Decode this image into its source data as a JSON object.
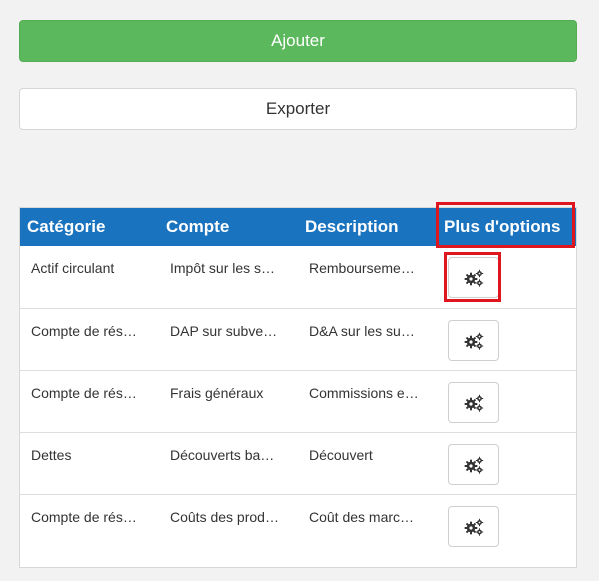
{
  "actions": {
    "add_label": "Ajouter",
    "export_label": "Exporter"
  },
  "table": {
    "headers": [
      "Catégorie",
      "Compte",
      "Description",
      "Plus d'options"
    ],
    "rows": [
      {
        "categorie": "Actif circulant",
        "compte": "Impôt sur les s…",
        "description": "Rembourseme…"
      },
      {
        "categorie": "Compte de rés…",
        "compte": "DAP sur subve…",
        "description": "D&A sur les su…"
      },
      {
        "categorie": "Compte de rés…",
        "compte": "Frais généraux",
        "description": "Commissions e…"
      },
      {
        "categorie": "Dettes",
        "compte": "Découverts ba…",
        "description": "Découvert"
      },
      {
        "categorie": "Compte de rés…",
        "compte": "Coûts des prod…",
        "description": "Coût des marc…"
      }
    ],
    "row_action_icon": "gears-icon"
  },
  "colors": {
    "add_button": "#5cb85c",
    "header_bg": "#1a73be",
    "highlight": "#e0161f"
  }
}
